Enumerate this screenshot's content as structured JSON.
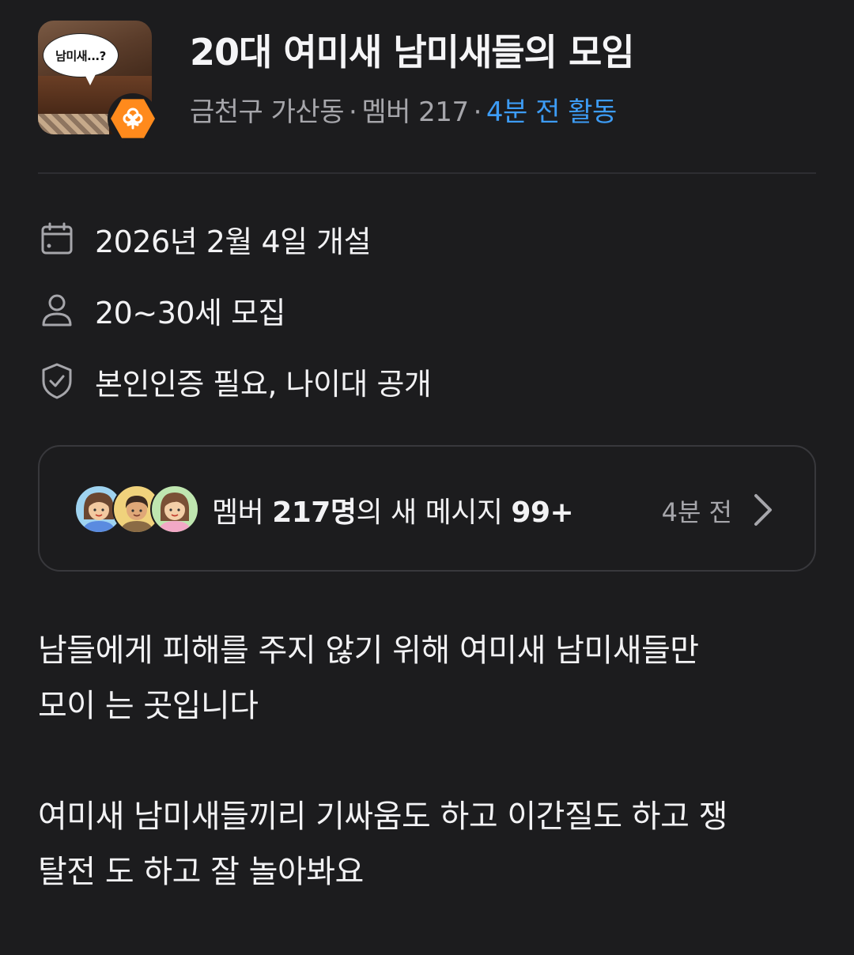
{
  "group": {
    "thumbnail_caption": "남미새...?",
    "badge_icon": "orange-hexagon-flower-icon",
    "title": "20대 여미새 남미새들의 모임",
    "location": "금천구 가산동",
    "separator": "·",
    "members_text": "멤버 217",
    "activity": "4분 전 활동",
    "activity_color": "#3d9cf5"
  },
  "info": {
    "opened": "2026년 2월 4일 개설",
    "opened_icon": "calendar-icon",
    "age": "20~30세 모집",
    "age_icon": "person-icon",
    "verification": "본인인증 필요, 나이대 공개",
    "verification_icon": "shield-check-icon"
  },
  "chat": {
    "prefix": "멤버 ",
    "member_count": "217명",
    "middle": "의 새 메시지 ",
    "message_count": "99+",
    "time": "4분 전",
    "chevron_icon": "chevron-right-icon"
  },
  "description": {
    "paragraph1": "남들에게 피해를 주지 않기 위해 여미새 남미새들만\n모이 는 곳입니다",
    "paragraph2": "여미새 남미새들끼리 기싸움도 하고 이간질도 하고 쟁\n탈전 도 하고 잘 놀아봐요"
  },
  "colors": {
    "background": "#1c1c1e",
    "text": "#f2f2f4",
    "muted": "#a6a6ab",
    "accent_orange": "#ff8a1c"
  }
}
